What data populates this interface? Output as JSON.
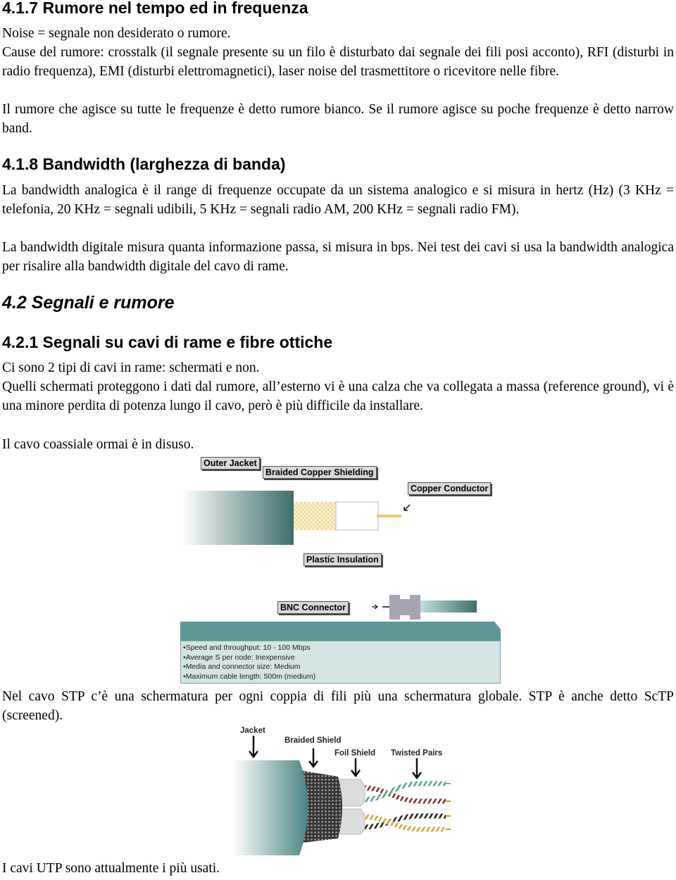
{
  "sections": {
    "s417": {
      "heading": "4.1.7 Rumore nel tempo ed in frequenza",
      "p1": "Noise = segnale non desiderato o rumore.",
      "p2": "Cause del rumore: crosstalk (il segnale presente su un filo è disturbato dai segnale dei fili posi acconto), RFI (disturbi in radio frequenza), EMI (disturbi elettromagnetici), laser noise del trasmettitore o ricevitore nelle fibre.",
      "p3": "Il rumore che agisce su tutte le frequenze è detto rumore bianco. Se il rumore agisce su poche frequenze è detto narrow band."
    },
    "s418": {
      "heading": "4.1.8 Bandwidth (larghezza di banda)",
      "p1": "La bandwidth analogica è il range di frequenze occupate da un sistema analogico e si misura in hertz (Hz) (3 KHz = telefonia, 20 KHz = segnali udibili, 5 KHz = segnali radio AM, 200 KHz = segnali radio FM).",
      "p2": "La bandwidth digitale misura quanta informazione passa, si misura in bps. Nei test dei cavi si usa la bandwidth analogica per risalire alla bandwidth digitale del cavo di rame."
    },
    "s42": {
      "heading": "4.2 Segnali e rumore"
    },
    "s421": {
      "heading": "4.2.1 Segnali su cavi di rame e fibre ottiche",
      "p1": "Ci sono 2 tipi di cavi in rame: schermati e non.",
      "p2": "Quelli schermati proteggono i dati dal rumore, all’esterno vi è una calza che va collegata a massa (reference ground), vi è una minore perdita di potenza lungo il cavo, però è più difficile da installare.",
      "p3": "Il cavo coassiale ormai è in disuso.",
      "p4": "Nel cavo STP c’è una schermatura per ogni coppia di fili più una schermatura globale. STP è anche detto ScTP (screened).",
      "p5": "I cavi UTP sono attualmente i più usati."
    }
  },
  "coax_figure": {
    "labels": {
      "outer_jacket": "Outer Jacket",
      "braided_shielding": "Braided Copper Shielding",
      "copper_conductor": "Copper Conductor",
      "plastic_insulation": "Plastic Insulation",
      "bnc_connector": "BNC Connector"
    },
    "specs": [
      "Speed and throughput: 10 - 100 Mbps",
      "Average S per node: Inexpensive",
      "Media and connector size: Medium",
      "Maximum cable length: 500m (medium)"
    ],
    "colors": {
      "jacket": "#3e6e6c",
      "braid": "#e8d27a",
      "panel_header": "#5f9796",
      "panel_body": "#d4e3e3"
    }
  },
  "stp_figure": {
    "labels": {
      "jacket": "Jacket",
      "braided_shield": "Braided Shield",
      "foil_shield": "Foil Shield",
      "twisted_pairs": "Twisted Pairs"
    }
  }
}
